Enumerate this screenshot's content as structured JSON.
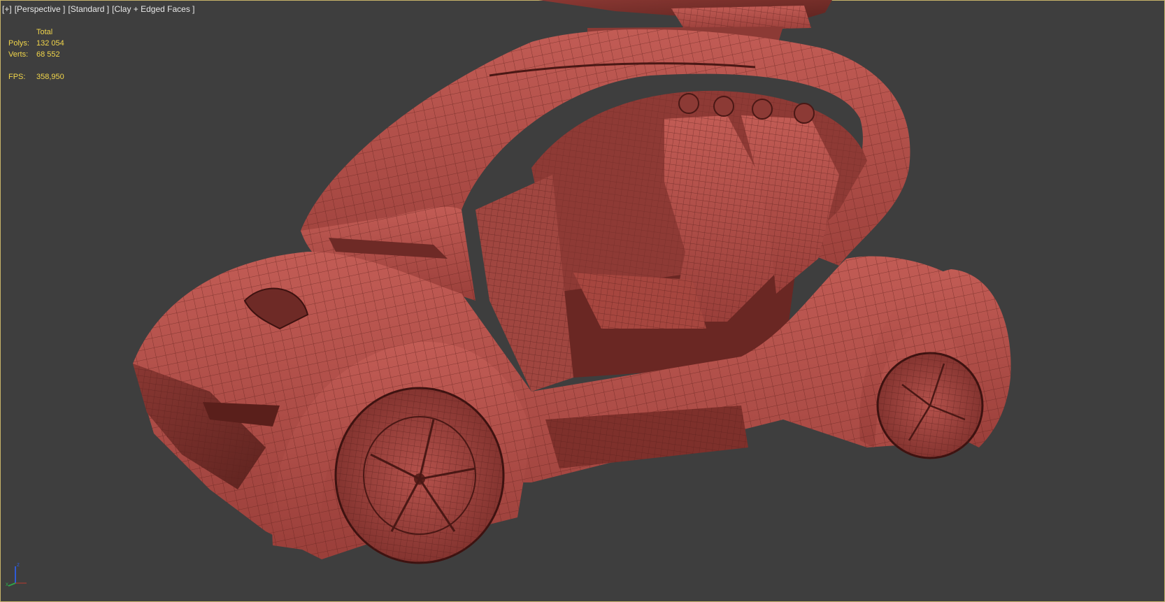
{
  "viewport": {
    "label_plus": "[+]",
    "label_view": "[Perspective ]",
    "label_shading": "[Standard ]",
    "label_style": "[Clay + Edged Faces ]"
  },
  "stats": {
    "total_label": "Total",
    "polys_label": "Polys:",
    "polys_value": "132 054",
    "verts_label": "Verts:",
    "verts_value": "68 552",
    "fps_label": "FPS:",
    "fps_value": "358,950"
  },
  "colors": {
    "background": "#3e3e3e",
    "stat_text": "#f2d64b",
    "clay": "#b4514b",
    "clay_dark": "#6e2a26",
    "viewport_border": "#c7b36a"
  },
  "gizmo": {
    "axis_z": "z",
    "axis_x": "x"
  }
}
